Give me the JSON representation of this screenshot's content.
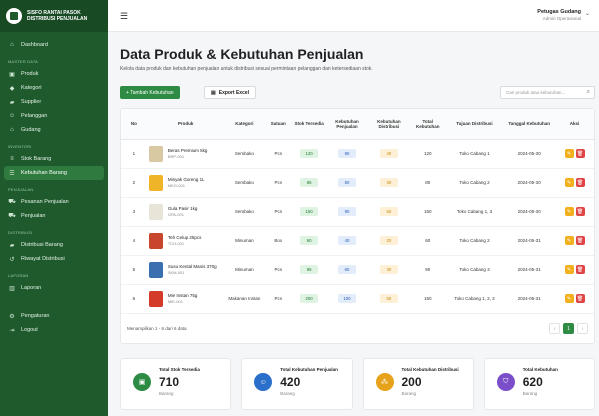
{
  "brand": {
    "line1": "SISFO RANTAI PASOK",
    "line2": "DISTRIBUSI PENJUALAN"
  },
  "sidebar": {
    "top": [
      {
        "label": "Dashboard",
        "icon": "home-icon"
      }
    ],
    "sections": [
      {
        "title": "MASTER DATA",
        "items": [
          {
            "label": "Produk",
            "icon": "box-icon"
          },
          {
            "label": "Kategori",
            "icon": "tag-icon"
          },
          {
            "label": "Supplier",
            "icon": "truck-icon"
          },
          {
            "label": "Pelanggan",
            "icon": "users-icon"
          },
          {
            "label": "Gudang",
            "icon": "warehouse-icon"
          }
        ]
      },
      {
        "title": "INVENTORI",
        "items": [
          {
            "label": "Stok Barang",
            "icon": "stack-icon"
          },
          {
            "label": "Kebutuhan Barang",
            "icon": "list-icon",
            "active": true
          }
        ]
      },
      {
        "title": "PENJUALAN",
        "items": [
          {
            "label": "Pesanan Penjualan",
            "icon": "cart-icon"
          },
          {
            "label": "Penjualan",
            "icon": "cart-icon"
          }
        ]
      },
      {
        "title": "DISTRIBUSI",
        "items": [
          {
            "label": "Distribusi Barang",
            "icon": "truck-icon"
          },
          {
            "label": "Riwayat Distribusi",
            "icon": "history-icon"
          }
        ]
      },
      {
        "title": "LAPORAN",
        "items": [
          {
            "label": "Laporan",
            "icon": "chart-icon"
          }
        ]
      }
    ],
    "bottom": [
      {
        "label": "Pengaturan",
        "icon": "gear-icon"
      },
      {
        "label": "Logout",
        "icon": "logout-icon"
      }
    ]
  },
  "topbar": {
    "user_name": "Petugas Gudang",
    "user_role": "Admin Operasional"
  },
  "page": {
    "title": "Data Produk & Kebutuhan Penjualan",
    "subtitle": "Kelola data produk dan kebutuhan penjualan untuk distribusi sesuai permintaan pelanggan dan ketersediaan stok."
  },
  "toolbar": {
    "add_label": "+ Tambah Kebutuhan",
    "export_label": "Export Excel",
    "search_placeholder": "Cari produk atau kebutuhan..."
  },
  "table": {
    "headers": [
      "No",
      "Produk",
      "Kategori",
      "Satuan",
      "Stok Tersedia",
      "Kebutuhan Penjualan",
      "Kebutuhan Distribusi",
      "Total Kebutuhan",
      "Tujuan Distribusi",
      "Tanggal Kebutuhan",
      "Aksi"
    ],
    "rows": [
      {
        "no": "1",
        "name": "Beras Premium 5kg",
        "code": "BRP-001",
        "kategori": "Sembako",
        "satuan": "Pcs",
        "stok": "120",
        "penjualan": "80",
        "distribusi": "40",
        "total": "120",
        "tujuan": "Toko Cabang 1",
        "tanggal": "2024-05-30",
        "thumb": "#d9c9a3"
      },
      {
        "no": "2",
        "name": "Minyak Goreng 1L",
        "code": "MKG-001",
        "kategori": "Sembako",
        "satuan": "Pcs",
        "stok": "85",
        "penjualan": "50",
        "distribusi": "30",
        "total": "80",
        "tujuan": "Toko Cabang 2",
        "tanggal": "2024-05-30",
        "thumb": "#f0b429"
      },
      {
        "no": "3",
        "name": "Gula Pasir 1kg",
        "code": "GPA-001",
        "kategori": "Sembako",
        "satuan": "Pcs",
        "stok": "150",
        "penjualan": "90",
        "distribusi": "60",
        "total": "150",
        "tujuan": "Toko Cabang 1, 3",
        "tanggal": "2024-05-30",
        "thumb": "#e8e4d8"
      },
      {
        "no": "4",
        "name": "Teh Celup 25pcs",
        "code": "TCH-001",
        "kategori": "Minuman",
        "satuan": "Box",
        "stok": "60",
        "penjualan": "40",
        "distribusi": "20",
        "total": "60",
        "tujuan": "Toko Cabang 2",
        "tanggal": "2024-05-31",
        "thumb": "#c8462e"
      },
      {
        "no": "5",
        "name": "Susu Kental Manis 370g",
        "code": "SKM-001",
        "kategori": "Minuman",
        "satuan": "Pcs",
        "stok": "95",
        "penjualan": "60",
        "distribusi": "30",
        "total": "90",
        "tujuan": "Toko Cabang 3",
        "tanggal": "2024-05-31",
        "thumb": "#3a6fb0"
      },
      {
        "no": "6",
        "name": "Mie Instan 75g",
        "code": "MIE-001",
        "kategori": "Makanan Instan",
        "satuan": "Pcs",
        "stok": "200",
        "penjualan": "100",
        "distribusi": "50",
        "total": "150",
        "tujuan": "Toko Cabang 1, 2, 3",
        "tanggal": "2024-05-31",
        "thumb": "#d43b2a"
      }
    ],
    "footer_info": "Menampilkan 1 - 6 dari 6 data",
    "page": "1"
  },
  "stats": [
    {
      "label": "Total Stok Tersedia",
      "value": "710",
      "unit": "Barang",
      "color": "#2e8b44",
      "icon": "box-icon"
    },
    {
      "label": "Total Kebutuhan Penjualan",
      "value": "420",
      "unit": "Barang",
      "color": "#2a6fc9",
      "icon": "users-icon"
    },
    {
      "label": "Total Kebutuhan Distribusi",
      "value": "200",
      "unit": "Barang",
      "color": "#e6a21a",
      "icon": "network-icon"
    },
    {
      "label": "Total Kebutuhan",
      "value": "620",
      "unit": "Barang",
      "color": "#7b4fc9",
      "icon": "shield-icon"
    }
  ]
}
